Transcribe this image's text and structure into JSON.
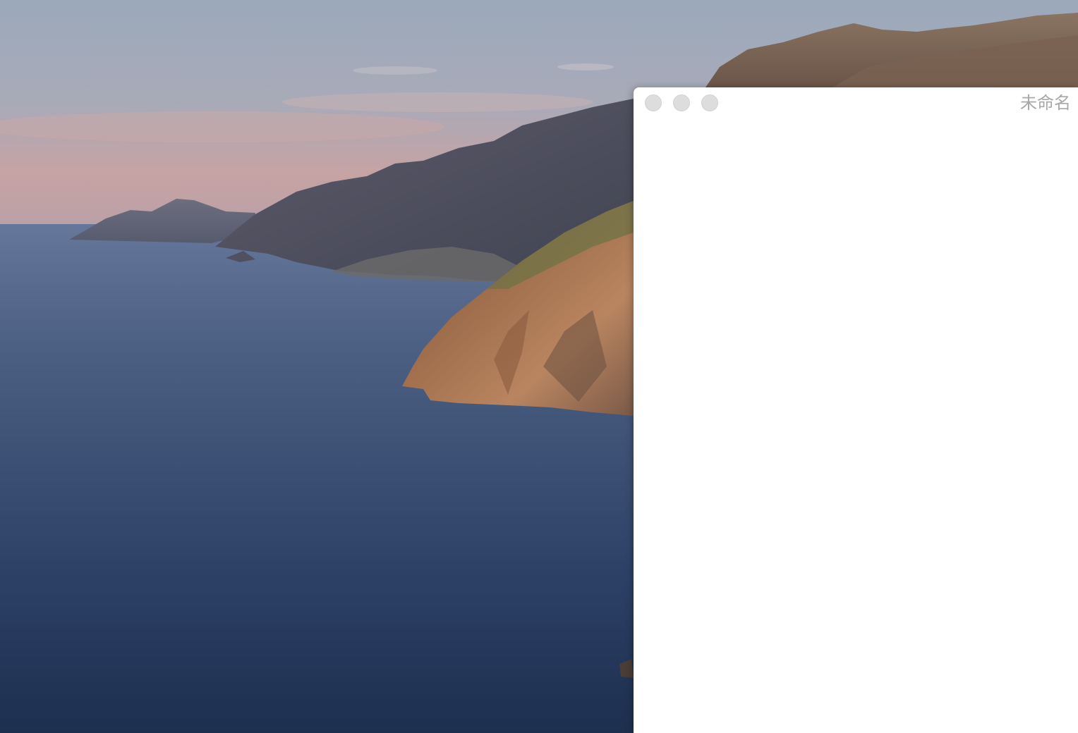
{
  "desktop": {
    "wallpaper": "coastal-cliffs-at-dusk",
    "colors": {
      "sky_top": "#9aa7b9",
      "sky_pink": "#c9a3a0",
      "sea_light": "#5e6f8f",
      "sea_dark": "#1e3050",
      "cliff_warm": "#b57a55"
    }
  },
  "window": {
    "title": "未命名",
    "controls": [
      "close",
      "minimize",
      "zoom"
    ],
    "colors": {
      "background": "#ffffff",
      "title_text": "#a8a8a8",
      "traffic_light_inactive": "#dddddd"
    }
  }
}
